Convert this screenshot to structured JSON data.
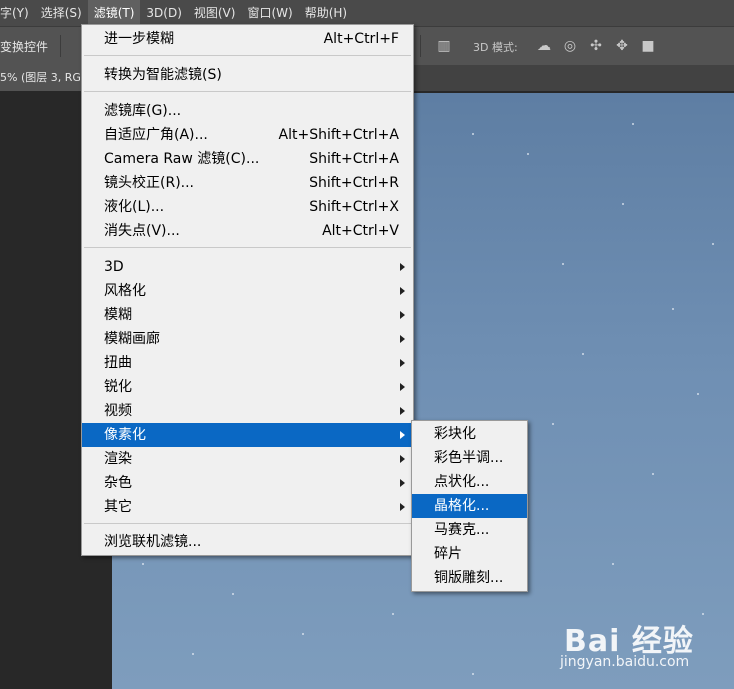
{
  "menubar": {
    "items": [
      {
        "label": "字(Y)"
      },
      {
        "label": "选择(S)"
      },
      {
        "label": "滤镜(T)"
      },
      {
        "label": "3D(D)"
      },
      {
        "label": "视图(V)"
      },
      {
        "label": "窗口(W)"
      },
      {
        "label": "帮助(H)"
      }
    ]
  },
  "options_bar": {
    "transform_label": "变换控件",
    "mode_3d_label": "3D 模式:",
    "icons": [
      "rotate-3d-icon",
      "roll-3d-icon",
      "drag-3d-icon",
      "slide-3d-icon",
      "scale-3d-icon"
    ]
  },
  "doc_tab": {
    "label": "5% (图层 3, RG"
  },
  "filter_menu": {
    "top": [
      {
        "label": "进一步模糊",
        "shortcut": "Alt+Ctrl+F"
      }
    ],
    "smart": [
      {
        "label": "转换为智能滤镜(S)"
      }
    ],
    "main": [
      {
        "label": "滤镜库(G)...",
        "shortcut": ""
      },
      {
        "label": "自适应广角(A)...",
        "shortcut": "Alt+Shift+Ctrl+A"
      },
      {
        "label": "Camera Raw 滤镜(C)...",
        "shortcut": "Shift+Ctrl+A"
      },
      {
        "label": "镜头校正(R)...",
        "shortcut": "Shift+Ctrl+R"
      },
      {
        "label": "液化(L)...",
        "shortcut": "Shift+Ctrl+X"
      },
      {
        "label": "消失点(V)...",
        "shortcut": "Alt+Ctrl+V"
      }
    ],
    "submenus": [
      {
        "label": "3D"
      },
      {
        "label": "风格化"
      },
      {
        "label": "模糊"
      },
      {
        "label": "模糊画廊"
      },
      {
        "label": "扭曲"
      },
      {
        "label": "锐化"
      },
      {
        "label": "视频"
      },
      {
        "label": "像素化"
      },
      {
        "label": "渲染"
      },
      {
        "label": "杂色"
      },
      {
        "label": "其它"
      }
    ],
    "browse": [
      {
        "label": "浏览联机滤镜..."
      }
    ]
  },
  "pixelate_menu": {
    "items": [
      {
        "label": "彩块化"
      },
      {
        "label": "彩色半调..."
      },
      {
        "label": "点状化..."
      },
      {
        "label": "晶格化..."
      },
      {
        "label": "马赛克..."
      },
      {
        "label": "碎片"
      },
      {
        "label": "铜版雕刻..."
      }
    ]
  },
  "watermark": {
    "logo": "Bai 经验",
    "url": "jingyan.baidu.com"
  },
  "colors": {
    "highlight": "#0a68c4",
    "menu_bg": "#f0f0f0",
    "menubar_bg": "#4a4a4a"
  }
}
